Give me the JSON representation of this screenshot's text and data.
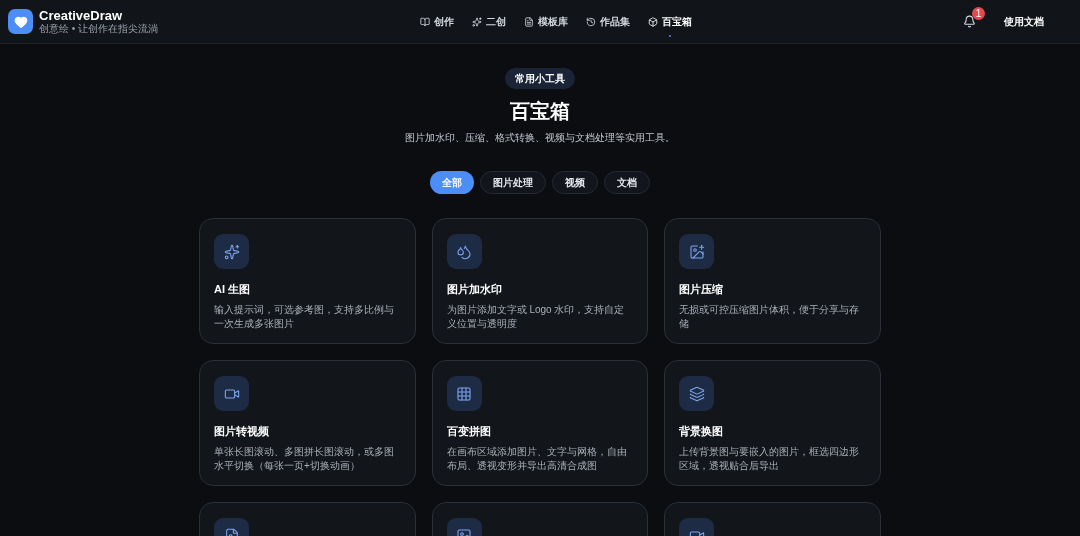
{
  "brand": {
    "name": "CreativeDraw",
    "tagline": "创意绘 • 让创作在指尖流淌"
  },
  "nav": [
    {
      "label": "创作",
      "selected": false
    },
    {
      "label": "二创",
      "selected": false
    },
    {
      "label": "模板库",
      "selected": false
    },
    {
      "label": "作品集",
      "selected": false
    },
    {
      "label": "百宝箱",
      "selected": true
    }
  ],
  "notifications": {
    "badge": "1"
  },
  "docs_button": "使用文档",
  "hero": {
    "tag": "常用小工具",
    "title": "百宝箱",
    "subtitle": "图片加水印、压缩、格式转换、视频与文档处理等实用工具。"
  },
  "filters": [
    {
      "label": "全部",
      "selected": true
    },
    {
      "label": "图片处理",
      "selected": false
    },
    {
      "label": "视频",
      "selected": false
    },
    {
      "label": "文档",
      "selected": false
    }
  ],
  "tools": [
    {
      "kind": "full",
      "title": "AI 生图",
      "description": "输入提示词，可选参考图，支持多比例与一次生成多张图片"
    },
    {
      "kind": "full",
      "title": "图片加水印",
      "description": "为图片添加文字或 Logo 水印，支持自定义位置与透明度"
    },
    {
      "kind": "full",
      "title": "图片压缩",
      "description": "无损或可控压缩图片体积，便于分享与存储"
    },
    {
      "kind": "full",
      "title": "图片转视频",
      "description": "单张长图滚动、多图拼长图滚动，或多图水平切换（每张一页+切换动画）"
    },
    {
      "kind": "full",
      "title": "百变拼图",
      "description": "在画布区域添加图片、文字与网格，自由布局、透视变形并导出高清合成图"
    },
    {
      "kind": "full",
      "title": "背景换图",
      "description": "上传背景图与要嵌入的图片，框选四边形区域，透视贴合后导出"
    },
    {
      "kind": "cut"
    },
    {
      "kind": "cut"
    },
    {
      "kind": "cut"
    }
  ]
}
